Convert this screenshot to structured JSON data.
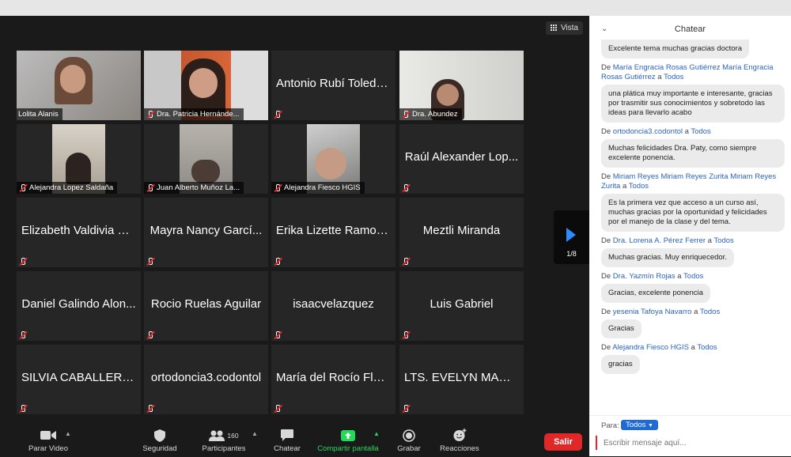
{
  "window": {
    "view_label": "Vista",
    "page_indicator": "1/8"
  },
  "tiles_video": [
    {
      "name": "Lolita Alanis"
    },
    {
      "name": "Dra. Patricia Hernánde..."
    },
    {
      "name": "Dra. Abundez"
    },
    {
      "name": "Alejandra Lopez Saldaña"
    },
    {
      "name": "Juan Alberto Muñoz La..."
    },
    {
      "name": "Alejandra Fiesco HGIS"
    }
  ],
  "tiles_text": [
    "Antonio Rubí Toleda...",
    "Raúl Alexander Lop...",
    "Elizabeth Valdivia O...",
    "Mayra Nancy Garcí...",
    "Erika Lizette Ramos...",
    "Meztli Miranda",
    "Daniel Galindo Alon...",
    "Rocio Ruelas Aguilar",
    "isaacvelazquez",
    "Luis Gabriel",
    "SILVIA CABALLERO...",
    "ortodoncia3.codontol",
    "María del Rocío Flor...",
    "LTS. EVELYN MARI..."
  ],
  "toolbar": {
    "video": "Parar Video",
    "security": "Seguridad",
    "participants": "Participantes",
    "participants_count": "160",
    "chat": "Chatear",
    "share": "Compartir pantalla",
    "record": "Grabar",
    "reactions": "Reacciones",
    "leave": "Salir"
  },
  "chat": {
    "title": "Chatear",
    "first_bubble": "Excelente tema muchas gracias doctora",
    "de": "De",
    "a": "a",
    "messages": [
      {
        "from": "María Engracia Rosas Gutiérrez María Engracia Rosas Gutiérrez",
        "to": "Todos",
        "text": "una plática muy importante e interesante, gracias por trasmitir sus conocimientos y sobretodo las ideas para llevarlo acabo"
      },
      {
        "from": "ortodoncia3.codontol",
        "to": "Todos",
        "text": "Muchas felicidades Dra. Paty, como siempre excelente ponencia."
      },
      {
        "from": "Miriam Reyes Miriam Reyes Zurita Miriam Reyes Zurita",
        "to": "Todos",
        "text": "Es la primera vez que acceso a un curso así, muchas gracias por la oportunidad y felicidades por el manejo de la clase y del tema."
      },
      {
        "from": "Dra. Lorena A. Pérez Ferrer",
        "to": "Todos",
        "text": "Muchas gracias. Muy enriquecedor."
      },
      {
        "from": "Dra. Yazmín Rojas",
        "to": "Todos",
        "text": "Gracias, excelente ponencia"
      },
      {
        "from": "yesenia Tafoya Navarro",
        "to": "Todos",
        "text": "Gracias"
      },
      {
        "from": "Alejandra Fiesco HGIS",
        "to": "Todos",
        "text": "gracias"
      }
    ],
    "to_label": "Para:",
    "to_value": "Todos",
    "input_placeholder": "Escribir mensaje aquí..."
  },
  "colors": {
    "accent": "#2d8cff",
    "leave": "#e02828",
    "share": "#23d959",
    "active_speaker": "#b9e64a",
    "chat_link": "#2a63c0"
  }
}
